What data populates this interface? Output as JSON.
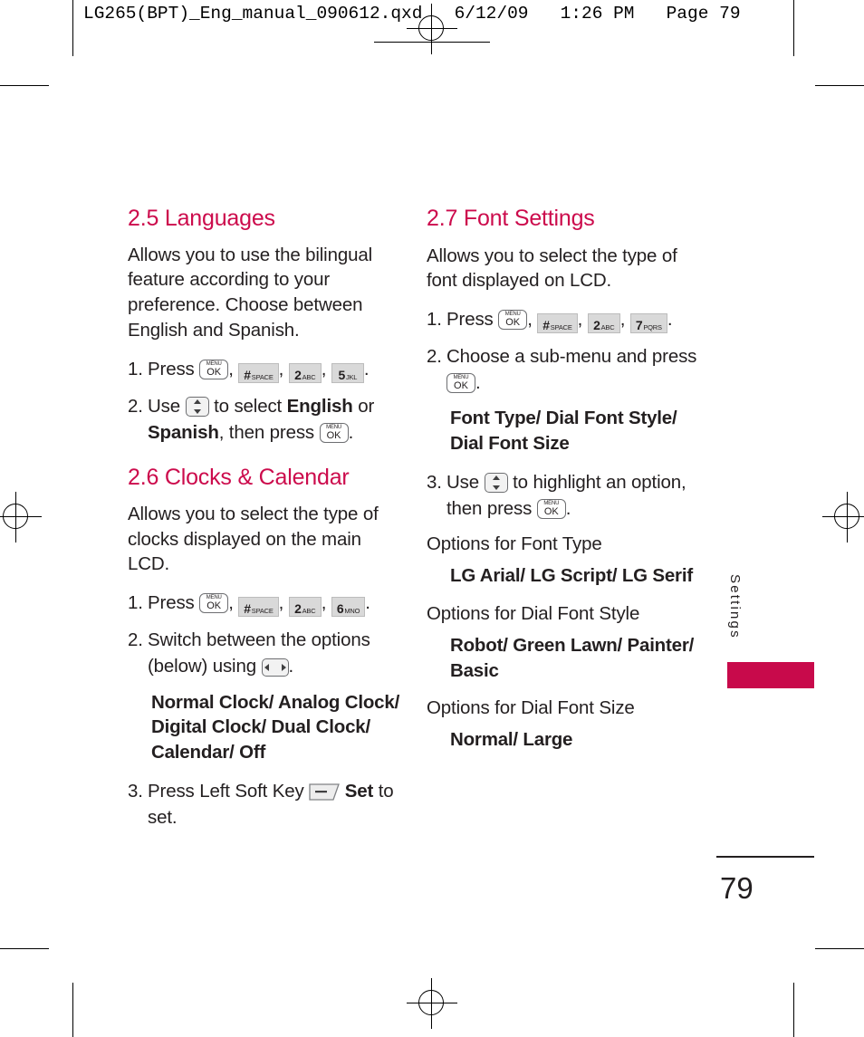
{
  "header": {
    "slug": "LG265(BPT)_Eng_manual_090612.qxd   6/12/09   1:26 PM   Page 79"
  },
  "colors": {
    "heading": "#cc0b4c",
    "accent_bar": "#c80a4b",
    "text": "#231f20",
    "key_pad_fill": "#d9d9d9"
  },
  "side_tab": {
    "label": "Settings"
  },
  "folio": {
    "page_number": "79"
  },
  "keys": {
    "menu_ok": {
      "line1": "MENU",
      "line2": "OK"
    },
    "hash_space": {
      "big": "#",
      "small": "SPACE"
    },
    "two_abc": {
      "big": "2",
      "small": "ABC"
    },
    "five_jkl": {
      "big": "5",
      "small": "JKL"
    },
    "six_mno": {
      "big": "6",
      "small": "MNO"
    },
    "seven_pqrs": {
      "big": "7",
      "small": "PQRS"
    }
  },
  "sections": [
    {
      "id": "languages",
      "title": "2.5 Languages",
      "intro": "Allows you to use the bilingual feature according to your preference. Choose between English and Spanish.",
      "step1": {
        "num": "1.",
        "lead": "Press",
        "sep": ",",
        "end": "."
      },
      "step2": {
        "num": "2.",
        "lead": "Use",
        "mid": "to select",
        "bold1": "English",
        "conj": "or",
        "bold2": "Spanish",
        "tail": ", then press",
        "end": "."
      }
    },
    {
      "id": "clocks-calendar",
      "title": "2.6 Clocks & Calendar",
      "intro": "Allows you to select the type of clocks displayed on the main LCD.",
      "step1": {
        "num": "1.",
        "lead": "Press",
        "sep": ",",
        "end": "."
      },
      "step2": {
        "num": "2.",
        "text_before": "Switch between the options (below) using",
        "end": "."
      },
      "options": "Normal Clock/ Analog Clock/ Digital Clock/ Dual Clock/ Calendar/ Off",
      "step3": {
        "num": "3.",
        "text_before": "Press Left Soft Key",
        "bold": "Set",
        "text_after": "to set."
      }
    },
    {
      "id": "font-settings",
      "title": "2.7 Font Settings",
      "intro": "Allows you to select the type of font displayed on LCD.",
      "step1": {
        "num": "1.",
        "lead": "Press",
        "sep": ",",
        "end": "."
      },
      "step2": {
        "num": "2.",
        "text_before": "Choose a sub-menu and press",
        "end": "."
      },
      "submenus": "Font Type/ Dial Font Style/ Dial Font Size",
      "step3": {
        "num": "3.",
        "lead": "Use",
        "mid": "to highlight an option, then press",
        "end": "."
      },
      "option_groups": [
        {
          "label": "Options for Font Type",
          "values": "LG Arial/ LG Script/ LG Serif"
        },
        {
          "label": "Options for Dial Font Style",
          "values": "Robot/ Green Lawn/ Painter/ Basic"
        },
        {
          "label": "Options for Dial Font Size",
          "values": "Normal/ Large"
        }
      ]
    }
  ]
}
